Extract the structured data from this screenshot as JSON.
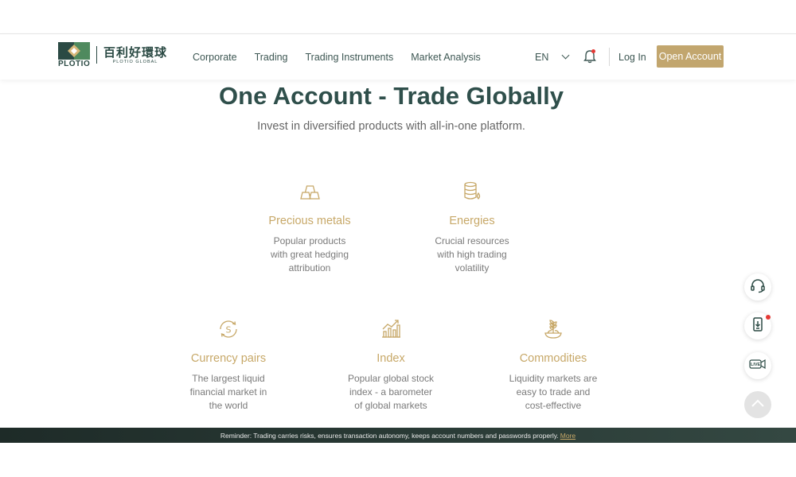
{
  "brand": {
    "name_en": "PLOTIO",
    "name_cn": "百利好環球",
    "name_cn_sub": "PLOTIO GLOBAL"
  },
  "nav": {
    "items": [
      "Corporate",
      "Trading",
      "Trading Instruments",
      "Market Analysis"
    ]
  },
  "header": {
    "language": "EN",
    "login_label": "Log In",
    "open_account_label": "Open Account"
  },
  "hero": {
    "title": "One Account - Trade Globally",
    "subtitle": "Invest in diversified products with all-in-one platform."
  },
  "products": [
    {
      "icon": "gold-bars-icon",
      "title": "Precious metals",
      "desc": "Popular products with great hedging attribution"
    },
    {
      "icon": "oil-barrel-icon",
      "title": "Energies",
      "desc": "Crucial resources with high trading volatility"
    },
    {
      "icon": "currency-exchange-icon",
      "title": "Currency pairs",
      "desc": "The largest liquid financial market in the world"
    },
    {
      "icon": "index-chart-icon",
      "title": "Index",
      "desc": "Popular global stock index - a barometer of global markets"
    },
    {
      "icon": "wheat-bowl-icon",
      "title": "Commodities",
      "desc": "Liquidity markets are easy to trade and cost-effective"
    }
  ],
  "floating": {
    "live_label": "LIVE"
  },
  "reminder": {
    "text": "Reminder: Trading carries risks, ensures transaction autonomy, keeps account numbers and passwords properly.",
    "more_label": "More"
  },
  "colors": {
    "brand_green": "#2b4a44",
    "gold": "#c2a66e",
    "notification_red": "#e53935"
  }
}
